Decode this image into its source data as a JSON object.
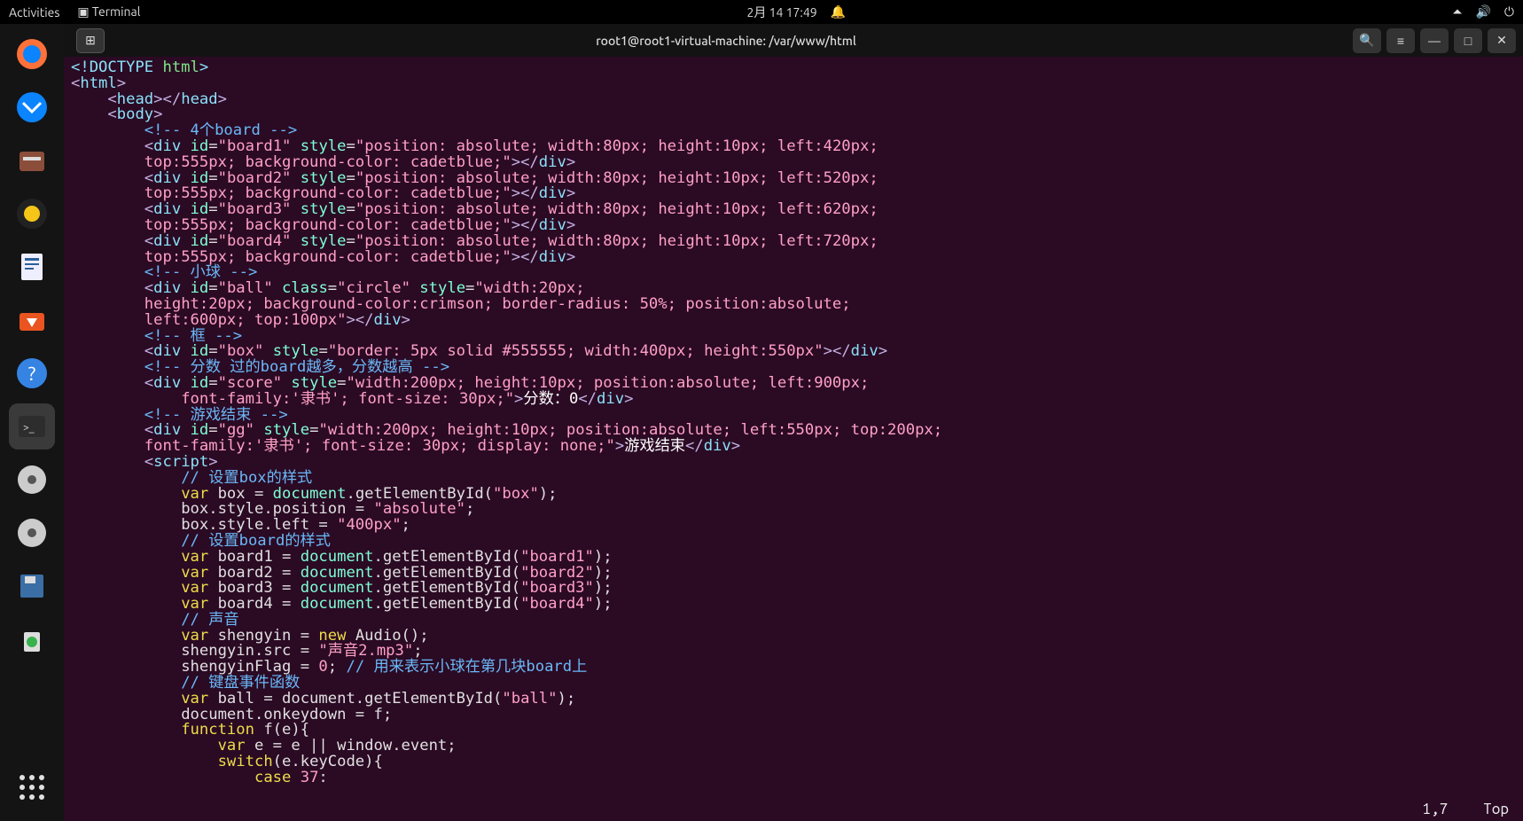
{
  "topbar": {
    "activities": "Activities",
    "app_label": "Terminal",
    "datetime": "2月 14  17:49"
  },
  "window": {
    "title": "root1@root1-virtual-machine: /var/www/html"
  },
  "status": {
    "pos": "1,7",
    "scroll": "Top"
  },
  "code": {
    "l1_a": "<!DOCTYPE ",
    "l1_b": "html",
    "l1_c": ">",
    "l2_a": "<",
    "l2_b": "html",
    "l2_c": ">",
    "l3_a": "<",
    "l3_b": "head",
    "l3_c": "></",
    "l3_d": "head",
    "l3_e": ">",
    "l4_a": "<",
    "l4_b": "body",
    "l4_c": ">",
    "l5": "<!-- 4个board -->",
    "l6a": "<",
    "l6b": "div",
    "l6c": " id",
    "l6d": "=",
    "l6e": "\"board1\"",
    "l6f": " style",
    "l6g": "=",
    "l6h": "\"position: absolute; width:80px; height:10px; left:420px;",
    "l7a": "top:555px; background-color: cadetblue;\"",
    "l7b": "></",
    "l7c": "div",
    "l7d": ">",
    "l8e": "\"board2\"",
    "l8h": "\"position: absolute; width:80px; height:10px; left:520px;",
    "l10e": "\"board3\"",
    "l10h": "\"position: absolute; width:80px; height:10px; left:620px;",
    "l12e": "\"board4\"",
    "l12h": "\"position: absolute; width:80px; height:10px; left:720px;",
    "l14": "<!-- 小球 -->",
    "l15e": "\"ball\"",
    "l15cls": " class",
    "l15clsv": "\"circle\"",
    "l15h": "\"width:20px;",
    "l16": "height:20px; background-color:crimson; border-radius: 50%; position:absolute;",
    "l17": "left:600px; top:100px\"",
    "l17b": "></",
    "l17c": "div",
    "l17d": ">",
    "l18": "<!-- 框 -->",
    "l19e": "\"box\"",
    "l19h": "\"border: 5px solid #555555; width:400px; height:550px\"",
    "l19b": "></",
    "l19c": "div",
    "l19d": ">",
    "l20": "<!-- 分数 过的board越多，分数越高 -->",
    "l21e": "\"score\"",
    "l21h": "\"width:200px; height:10px; position:absolute; left:900px;",
    "l22": "    font-family:'隶书'; font-size: 30px;\"",
    "l22t": "分数：0",
    "l22b": "</",
    "l22c": "div",
    "l22d": ">",
    "l23": "<!-- 游戏结束 -->",
    "l24e": "\"gg\"",
    "l24h": "\"width:200px; height:10px; position:absolute; left:550px; top:200px;",
    "l25": "font-family:'隶书'; font-size: 30px; display: none;\"",
    "l25t": "游戏结束",
    "l25b": "</",
    "l25c": "div",
    "l25d": ">",
    "l26a": "<",
    "l26b": "script",
    "l26c": ">",
    "l27": "// 设置box的样式",
    "l28a": "var",
    "l28b": " box = ",
    "l28c": "document",
    "l28d": ".getElementById(",
    "l28e": "\"box\"",
    "l28f": ");",
    "l29": "box.style.position = ",
    "l29s": "\"absolute\"",
    "l29e": ";",
    "l30": "box.style.left = ",
    "l30s": "\"400px\"",
    "l30e": ";",
    "l31": "// 设置board的样式",
    "l32b": " board1 = ",
    "l32e": "\"board1\"",
    "l33b": " board2 = ",
    "l33e": "\"board2\"",
    "l34b": " board3 = ",
    "l34e": "\"board3\"",
    "l35b": " board4 = ",
    "l35e": "\"board4\"",
    "l36": "// 声音",
    "l37a": "var",
    "l37b": " shengyin = ",
    "l37c": "new",
    "l37d": " Audio();",
    "l38": "shengyin.src = ",
    "l38s": "\"声音2.mp3\"",
    "l38e": ";",
    "l39a": "shengyinFlag = ",
    "l39n": "0",
    "l39b": "; ",
    "l39c": "// 用来表示小球在第几块board上",
    "l40": "// 键盘事件函数",
    "l41a": "var",
    "l41b": " ball = document.getElementById(",
    "l41s": "\"ball\"",
    "l41e": ");",
    "l42": "document.onkeydown = f;",
    "l43a": "function",
    "l43b": " f(e){",
    "l44a": "var",
    "l44b": " e = e || window.event;",
    "l45a": "switch",
    "l45b": "(e.keyCode){",
    "l46a": "case",
    "l46b": " 37",
    "l46c": ":"
  }
}
